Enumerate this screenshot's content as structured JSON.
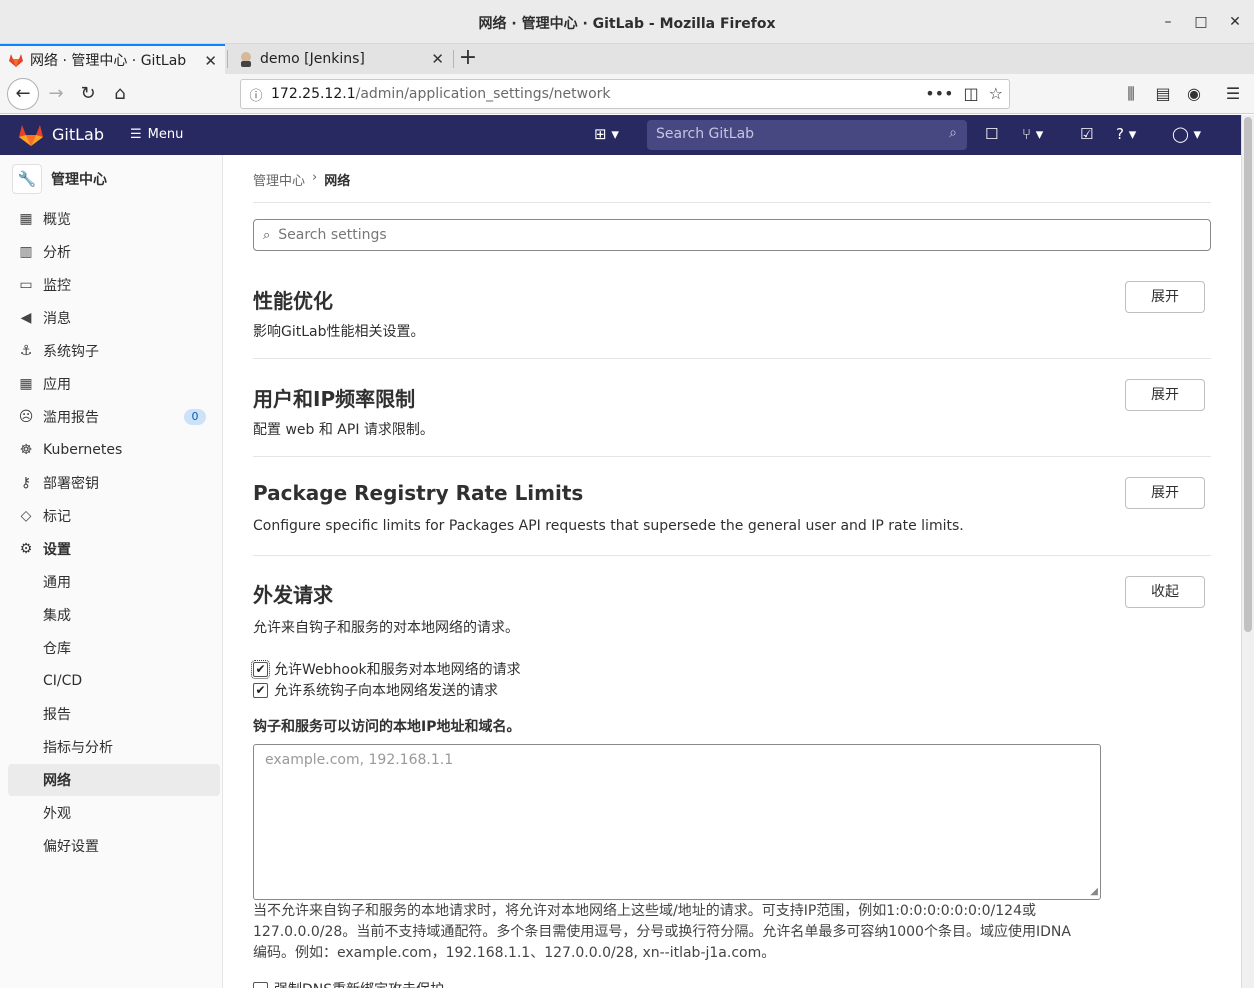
{
  "window": {
    "title": "网络 · 管理中心 · GitLab - Mozilla Firefox",
    "minimize": "–",
    "maximize": "□",
    "close": "✕"
  },
  "tabs": [
    {
      "label": "网络 · 管理中心 · GitLab",
      "active": true
    },
    {
      "label": "demo [Jenkins]",
      "active": false
    }
  ],
  "nav": {
    "url_host": "172.25.12.1",
    "url_path": "/admin/application_settings/network"
  },
  "gitlab_header": {
    "brand": "GitLab",
    "menu_label": "Menu",
    "search_placeholder": "Search GitLab",
    "brand_color": "#292961"
  },
  "sidebar": {
    "context": "管理中心",
    "items": [
      {
        "label": "概览",
        "icon": "overview-icon"
      },
      {
        "label": "分析",
        "icon": "analytics-icon"
      },
      {
        "label": "监控",
        "icon": "monitor-icon"
      },
      {
        "label": "消息",
        "icon": "messages-icon"
      },
      {
        "label": "系统钩子",
        "icon": "hook-icon"
      },
      {
        "label": "应用",
        "icon": "applications-icon"
      },
      {
        "label": "滥用报告",
        "icon": "abuse-icon",
        "badge": "0"
      },
      {
        "label": "Kubernetes",
        "icon": "kubernetes-icon"
      },
      {
        "label": "部署密钥",
        "icon": "key-icon"
      },
      {
        "label": "标记",
        "icon": "label-icon"
      },
      {
        "label": "设置",
        "icon": "settings-icon"
      }
    ],
    "settings_sub": [
      {
        "label": "通用"
      },
      {
        "label": "集成"
      },
      {
        "label": "仓库"
      },
      {
        "label": "CI/CD"
      },
      {
        "label": "报告"
      },
      {
        "label": "指标与分析"
      },
      {
        "label": "网络"
      },
      {
        "label": "外观"
      },
      {
        "label": "偏好设置"
      }
    ]
  },
  "main": {
    "breadcrumb": [
      "管理中心",
      "网络"
    ],
    "breadcrumb_sep": "›",
    "settings_search_placeholder": "Search settings",
    "sections": [
      {
        "title": "性能优化",
        "desc": "影响GitLab性能相关设置。",
        "button": "展开"
      },
      {
        "title": "用户和IP频率限制",
        "desc": "配置 web 和 API 请求限制。",
        "button": "展开"
      },
      {
        "title": "Package Registry Rate Limits",
        "desc": "Configure specific limits for Packages API requests that supersede the general user and IP rate limits.",
        "button": "展开"
      },
      {
        "title": "外发请求",
        "desc": "允许来自钩子和服务的对本地网络的请求。",
        "button": "收起"
      }
    ],
    "outbound": {
      "checkbox_webhooks": "允许Webhook和服务对本地网络的请求",
      "checkbox_system_hooks": "允许系统钩子向本地网络发送的请求",
      "allowlist_label": "钩子和服务可以访问的本地IP地址和域名。",
      "allowlist_placeholder": "example.com, 192.168.1.1",
      "help_text": "当不允许来自钩子和服务的本地请求时，将允许对本地网络上这些域/地址的请求。可支持IP范围，例如1:0:0:0:0:0:0:0/124或127.0.0.0/28。当前不支持域通配符。多个条目需使用逗号，分号或换行符分隔。允许名单最多可容纳1000个条目。域应使用IDNA编码。例如：example.com，192.168.1.1、127.0.0.0/28, xn--itlab-j1a.com。",
      "dns_checkbox": "强制DNS重新绑定攻击保护"
    }
  }
}
